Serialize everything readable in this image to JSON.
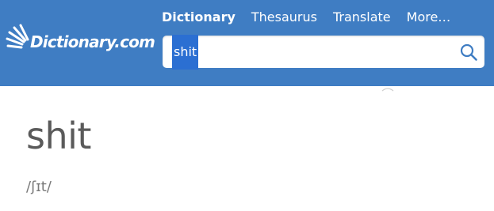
{
  "brand": {
    "logo_text": "Dictionary.com",
    "header_color": "#3f7dc3"
  },
  "nav": {
    "items": [
      {
        "label": "Dictionary",
        "active": true
      },
      {
        "label": "Thesaurus",
        "active": false
      },
      {
        "label": "Translate",
        "active": false
      },
      {
        "label": "More…",
        "active": false
      }
    ]
  },
  "search": {
    "value": "shit",
    "selected": true,
    "button_icon": "search-icon"
  },
  "entry": {
    "headword": "shit",
    "pronunciation": "/ʃɪt/"
  }
}
